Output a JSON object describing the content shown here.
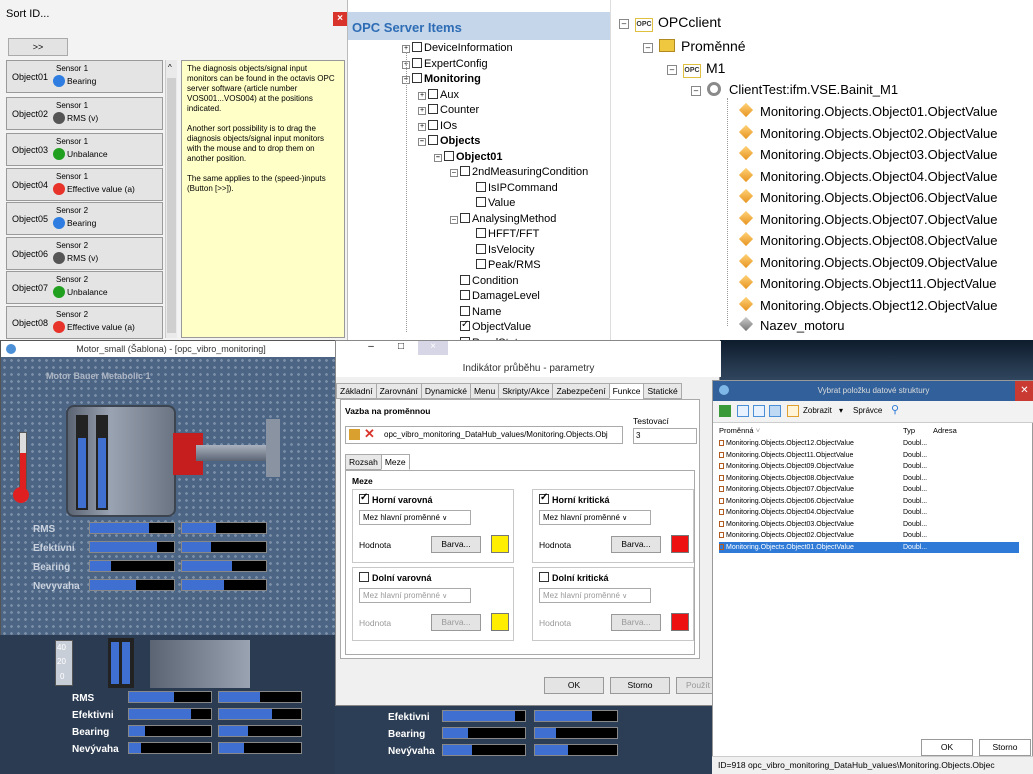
{
  "sort_pane": {
    "title": "Sort ID...",
    "close": "×",
    "next_button": ">>",
    "objects": [
      {
        "id": "Object01",
        "sensor": "Sensor 1",
        "measure": "Bearing",
        "icon": "bearing-icon",
        "color": "#2f7de0"
      },
      {
        "id": "Object02",
        "sensor": "Sensor 1",
        "measure": "RMS (v)",
        "icon": "rms-icon",
        "color": "#555555"
      },
      {
        "id": "Object03",
        "sensor": "Sensor 1",
        "measure": "Unbalance",
        "icon": "unbalance-icon",
        "color": "#21a020"
      },
      {
        "id": "Object04",
        "sensor": "Sensor 1",
        "measure": "Effective value (a)",
        "icon": "effective-icon",
        "color": "#e8332a"
      },
      {
        "id": "Object05",
        "sensor": "Sensor 2",
        "measure": "Bearing",
        "icon": "bearing-icon",
        "color": "#2f7de0"
      },
      {
        "id": "Object06",
        "sensor": "Sensor 2",
        "measure": "RMS (v)",
        "icon": "rms-icon",
        "color": "#555555"
      },
      {
        "id": "Object07",
        "sensor": "Sensor 2",
        "measure": "Unbalance",
        "icon": "unbalance-icon",
        "color": "#21a020"
      },
      {
        "id": "Object08",
        "sensor": "Sensor 2",
        "measure": "Effective value (a)",
        "icon": "effective-icon",
        "color": "#e8332a"
      }
    ],
    "help": [
      "The diagnosis objects/signal input monitors can be found in the octavis OPC server software (article number VOS001...VOS004) at the positions indicated.",
      "Another sort possibility is to drag the diagnosis objects/signal input monitors with the mouse and to drop them on another position.",
      "The same applies to the (speed-)inputs (Button [>>])."
    ]
  },
  "opc_server": {
    "title": "OPC Server Items",
    "nodes": [
      "DeviceInformation",
      "ExpertConfig",
      "Monitoring",
      "Aux",
      "Counter",
      "IOs",
      "Objects",
      "Object01",
      "2ndMeasuringCondition",
      "IsIPCommand",
      "Value",
      "AnalysingMethod",
      "HFFT/FFT",
      "IsVelocity",
      "Peak/RMS",
      "Condition",
      "DamageLevel",
      "Name",
      "ObjectValue",
      "ReadState"
    ]
  },
  "opc_client": {
    "root": "OPCclient",
    "folder": "Proměnné",
    "m1": "M1",
    "client": "ClientTest:ifm.VSE.Bainit_M1",
    "items": [
      "Monitoring.Objects.Object01.ObjectValue",
      "Monitoring.Objects.Object02.ObjectValue",
      "Monitoring.Objects.Object03.ObjectValue",
      "Monitoring.Objects.Object04.ObjectValue",
      "Monitoring.Objects.Object06.ObjectValue",
      "Monitoring.Objects.Object07.ObjectValue",
      "Monitoring.Objects.Object08.ObjectValue",
      "Monitoring.Objects.Object09.ObjectValue",
      "Monitoring.Objects.Object11.ObjectValue",
      "Monitoring.Objects.Object12.ObjectValue"
    ],
    "last": "Nazev_motoru"
  },
  "motor_window": {
    "title": "Motor_small (Šablona) - [opc_vibro_monitoring]",
    "heading": "Motor Bauer Metabolic 1",
    "bar_labels": [
      "RMS",
      "Efektivni",
      "Bearing",
      "Nevyvaha"
    ],
    "upper_levels": [
      0.7,
      0.4,
      0.8,
      0.35,
      0.25,
      0.6,
      0.55,
      0.5
    ],
    "lower_labels": [
      "RMS",
      "Efektivni",
      "Bearing",
      "Nevývaha"
    ],
    "lower_levels": [
      0.55,
      0.5,
      0.75,
      0.65,
      0.2,
      0.35,
      0.15,
      0.3
    ],
    "mid_labels": [
      "Efektivni",
      "Bearing",
      "Nevývaha"
    ],
    "mid_levels": [
      0.88,
      0.7,
      0.3,
      0.25,
      0.35,
      0.4
    ],
    "scale": [
      "40",
      "20",
      "0"
    ],
    "gauge": "100"
  },
  "indikator": {
    "title": "Indikátor průběhu - parametry",
    "window_buttons": [
      "–",
      "□",
      "×"
    ],
    "tabs": [
      "Základní",
      "Zarovnání",
      "Dynamické",
      "Menu",
      "Skripty/Akce",
      "Zabezpečení",
      "Funkce",
      "Statické"
    ],
    "active_tab": "Funkce",
    "binding_label": "Vazba na proměnnou",
    "binding_value": "opc_vibro_monitoring_DataHub_values/Monitoring.Objects.Obj",
    "test_label": "Testovací hodnota",
    "test_value": "3",
    "subtabs": [
      "Rozsah",
      "Meze"
    ],
    "group_title": "Meze",
    "limits": [
      {
        "title": "Horní varovná",
        "checked": true,
        "select": "Mez hlavní proměnné",
        "value_label": "Hodnota",
        "button": "Barva...",
        "color": "#ffee00"
      },
      {
        "title": "Horní kritická",
        "checked": true,
        "select": "Mez hlavní proměnné",
        "value_label": "Hodnota",
        "button": "Barva...",
        "color": "#ee1111"
      },
      {
        "title": "Dolní varovná",
        "checked": false,
        "select": "Mez hlavní proměnné",
        "value_label": "Hodnota",
        "button": "Barva...",
        "color": "#ffee00"
      },
      {
        "title": "Dolní kritická",
        "checked": false,
        "select": "Mez hlavní proměnné",
        "value_label": "Hodnota",
        "button": "Barva...",
        "color": "#ee1111"
      }
    ],
    "ok": "OK",
    "cancel": "Storno",
    "apply": "Použít"
  },
  "vybrat": {
    "title": "Vybrat položku datové struktury",
    "toolbar_view": "Zobrazit",
    "toolbar_manager": "Správce",
    "col_name": "Proměnná",
    "col_type": "Typ",
    "col_address": "Adresa",
    "rows": [
      {
        "name": "Monitoring.Objects.Object12.ObjectValue",
        "type": "Doubl..."
      },
      {
        "name": "Monitoring.Objects.Object11.ObjectValue",
        "type": "Doubl..."
      },
      {
        "name": "Monitoring.Objects.Object09.ObjectValue",
        "type": "Doubl..."
      },
      {
        "name": "Monitoring.Objects.Object08.ObjectValue",
        "type": "Doubl..."
      },
      {
        "name": "Monitoring.Objects.Object07.ObjectValue",
        "type": "Doubl..."
      },
      {
        "name": "Monitoring.Objects.Object06.ObjectValue",
        "type": "Doubl..."
      },
      {
        "name": "Monitoring.Objects.Object04.ObjectValue",
        "type": "Doubl..."
      },
      {
        "name": "Monitoring.Objects.Object03.ObjectValue",
        "type": "Doubl..."
      },
      {
        "name": "Monitoring.Objects.Object02.ObjectValue",
        "type": "Doubl..."
      },
      {
        "name": "Monitoring.Objects.Object01.ObjectValue",
        "type": "Doubl...",
        "selected": true
      }
    ],
    "ok": "OK",
    "cancel": "Storno",
    "status": "ID=918  opc_vibro_monitoring_DataHub_values\\Monitoring.Objects.Objec"
  }
}
